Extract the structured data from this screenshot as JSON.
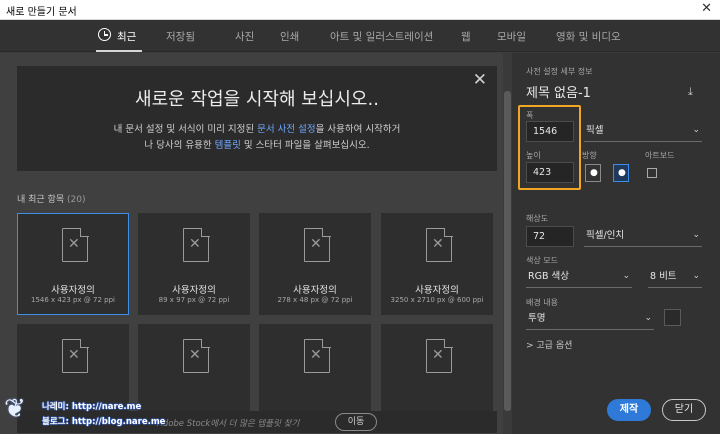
{
  "window": {
    "title": "새로 만들기 문서",
    "close_glyph": "✕"
  },
  "tabs": [
    {
      "label": "최근",
      "active": true
    },
    {
      "label": "저장됨"
    },
    {
      "label": "사진"
    },
    {
      "label": "인쇄"
    },
    {
      "label": "아트 및 일러스트레이션"
    },
    {
      "label": "웹"
    },
    {
      "label": "모바일"
    },
    {
      "label": "영화 및 비디오"
    }
  ],
  "welcome": {
    "close_glyph": "✕",
    "heading": "새로운 작업을 시작해 보십시오..",
    "line1_pre": "내 문서 설정 및 서식이 미리 지정된 ",
    "line1_link": "문서 사전 설정",
    "line1_post": "을 사용하여 시작하거",
    "line2_pre": "나 당사의 유용한 ",
    "line2_link": "템플릿",
    "line2_post": " 및 스타터 파일을 살펴보십시오."
  },
  "recent": {
    "label": "내 최근 항목",
    "count": "(20)",
    "items": [
      {
        "name": "사용자정의",
        "meta": "1546 x 423 px @ 72 ppi",
        "selected": true
      },
      {
        "name": "사용자정의",
        "meta": "89 x 97 px @ 72 ppi"
      },
      {
        "name": "사용자정의",
        "meta": "278 x 48 px @ 72 ppi"
      },
      {
        "name": "사용자정의",
        "meta": "3250 x 2710 px @ 600 ppi"
      },
      {
        "name": "",
        "meta": ""
      },
      {
        "name": "",
        "meta": ""
      },
      {
        "name": "",
        "meta": ""
      },
      {
        "name": "",
        "meta": ""
      }
    ]
  },
  "stock": {
    "text": "Adobe Stock에서 더 많은 템플릿 찾기",
    "button": "이동"
  },
  "preset": {
    "section_label": "사전 설정 세부 정보",
    "doc_title": "제목 없음-1",
    "save_icon": "⤓",
    "width_label": "폭",
    "width_value": "1546",
    "unit": "픽셀",
    "height_label": "높이",
    "height_value": "423",
    "orientation_label": "방향",
    "artboard_label": "아트보드",
    "resolution_label": "해상도",
    "resolution_value": "72",
    "resolution_unit": "픽셀/인치",
    "color_mode_label": "색상 모드",
    "color_mode_value": "RGB 색상",
    "bit_depth": "8 비트",
    "background_label": "배경 내용",
    "background_value": "투명",
    "advanced_label": "> 고급 옵션",
    "highlight_color": "#f2a724"
  },
  "buttons": {
    "create": "제작",
    "close": "닫기"
  },
  "watermark": {
    "line1": "나레미: http://nare.me",
    "line2": "블로그: http://blog.nare.me"
  }
}
